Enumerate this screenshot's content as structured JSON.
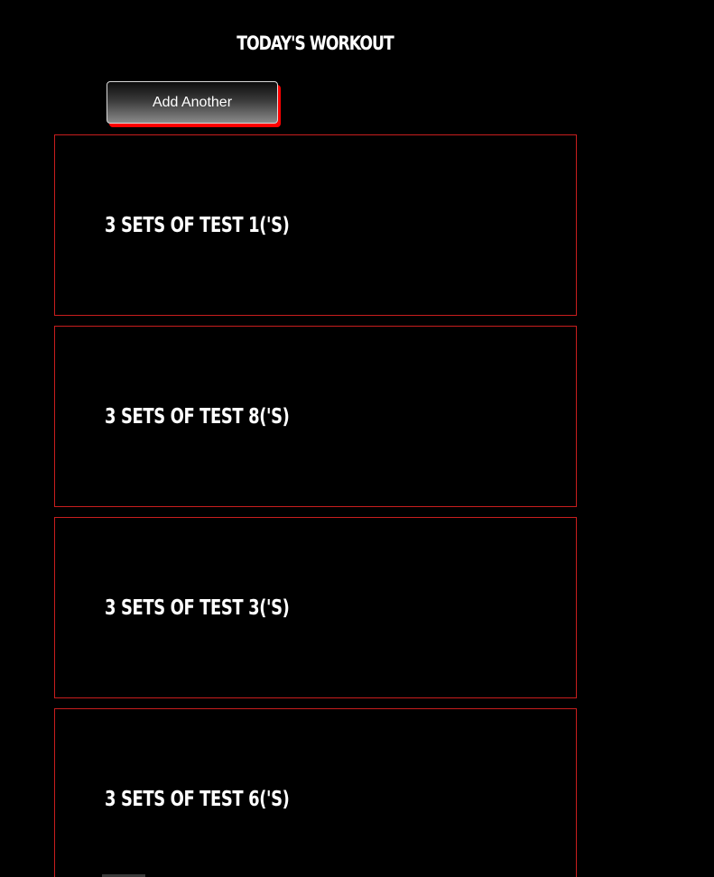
{
  "header": {
    "title": "TODAY'S WORKOUT"
  },
  "actions": {
    "add_label": "Add Another"
  },
  "workouts": [
    {
      "label": "3 SETS OF TEST 1('S)"
    },
    {
      "label": "3 SETS OF TEST 8('S)"
    },
    {
      "label": "3 SETS OF TEST 3('S)"
    },
    {
      "label": "3 SETS OF TEST 6('S)"
    }
  ],
  "colors": {
    "background": "#000000",
    "accent": "#ff0000",
    "card_border": "#c81e1e",
    "text": "#ffffff"
  }
}
